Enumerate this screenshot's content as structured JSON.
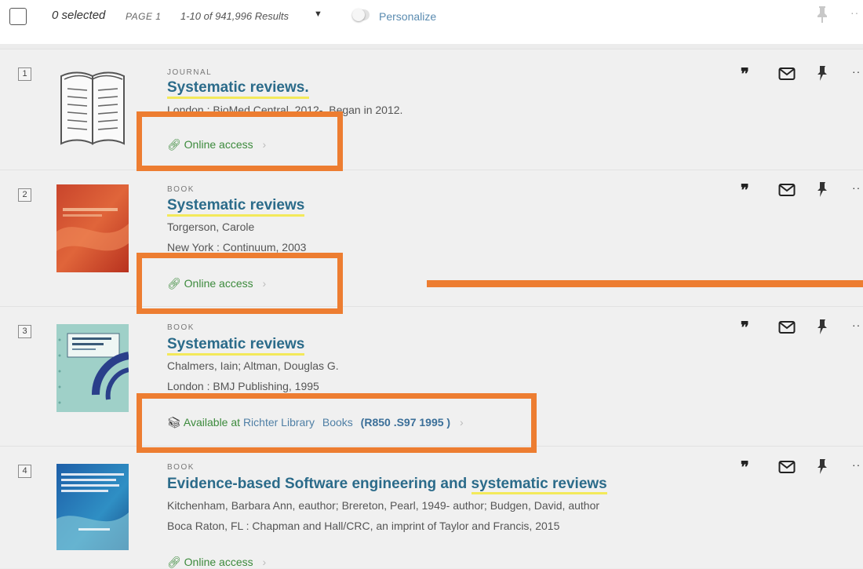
{
  "toolbar": {
    "selected": "0 selected",
    "page": "PAGE 1",
    "results": "1-10 of 941,996 Results",
    "caret": "▼",
    "personalize": "Personalize",
    "more": "··"
  },
  "results": [
    {
      "number": "1",
      "type": "JOURNAL",
      "title": "Systematic reviews.",
      "lines": [
        "London : BioMed Central, 2012-, Began in 2012."
      ],
      "access": "Online access",
      "thumb": "journal-icon"
    },
    {
      "number": "2",
      "type": "BOOK",
      "title": "Systematic reviews",
      "lines": [
        "Torgerson, Carole",
        "New York : Continuum, 2003"
      ],
      "access": "Online access",
      "thumb": "book-cover-red"
    },
    {
      "number": "3",
      "type": "BOOK",
      "title": "Systematic reviews",
      "lines": [
        "Chalmers, Iain; Altman, Douglas G.",
        "London : BMJ Publishing, 1995"
      ],
      "availability": {
        "prefix": "Available at",
        "library": "Richter Library",
        "location": "Books",
        "call_number": "(R850 .S97 1995 )"
      },
      "thumb": "book-cover-teal"
    },
    {
      "number": "4",
      "type": "BOOK",
      "title_parts": [
        "Evidence-based Software engineering and ",
        "systematic reviews"
      ],
      "lines": [
        "Kitchenham, Barbara Ann, eauthor; Brereton, Pearl, 1949- author; Budgen, David, author",
        "Boca Raton, FL : Chapman and Hall/CRC, an imprint of Taylor and Francis, 2015"
      ],
      "access": "Online access",
      "thumb": "book-cover-blue"
    }
  ],
  "actions": {
    "quote": "❞",
    "more": "··"
  },
  "colors": {
    "annotation": "#ed7d31",
    "title": "#2b6b8a",
    "highlight": "#f3e95a",
    "access": "#3c8a3c",
    "link": "#4f7fa5"
  }
}
